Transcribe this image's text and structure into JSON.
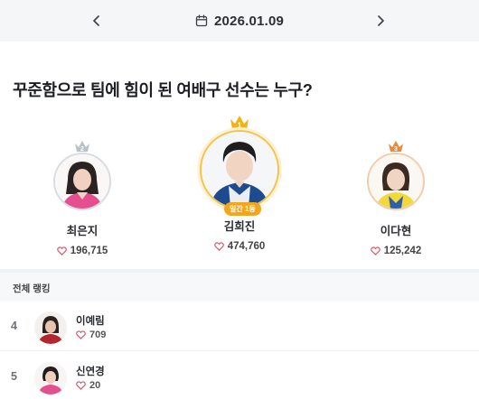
{
  "header": {
    "date": "2026.01.09"
  },
  "question": "꾸준함으로 팀에 힘이 된 여배구 선수는 누구?",
  "podium": [
    {
      "rank": "2",
      "name": "최은지",
      "votes": "196,715",
      "crown_color": "#b9c2cc"
    },
    {
      "rank": "1",
      "name": "김희진",
      "votes": "474,760",
      "crown_color": "#f2b318",
      "badge": "일간 1등"
    },
    {
      "rank": "3",
      "name": "이다현",
      "votes": "125,242",
      "crown_color": "#e9893c"
    }
  ],
  "ranking": {
    "title": "전체 랭킹",
    "rows": [
      {
        "rank": "4",
        "name": "이예림",
        "votes": "709"
      },
      {
        "rank": "5",
        "name": "신연경",
        "votes": "20"
      }
    ]
  },
  "colors": {
    "heart": "#e2475b",
    "accent": "#f3a51c",
    "header_bg": "#f5f6f8"
  }
}
